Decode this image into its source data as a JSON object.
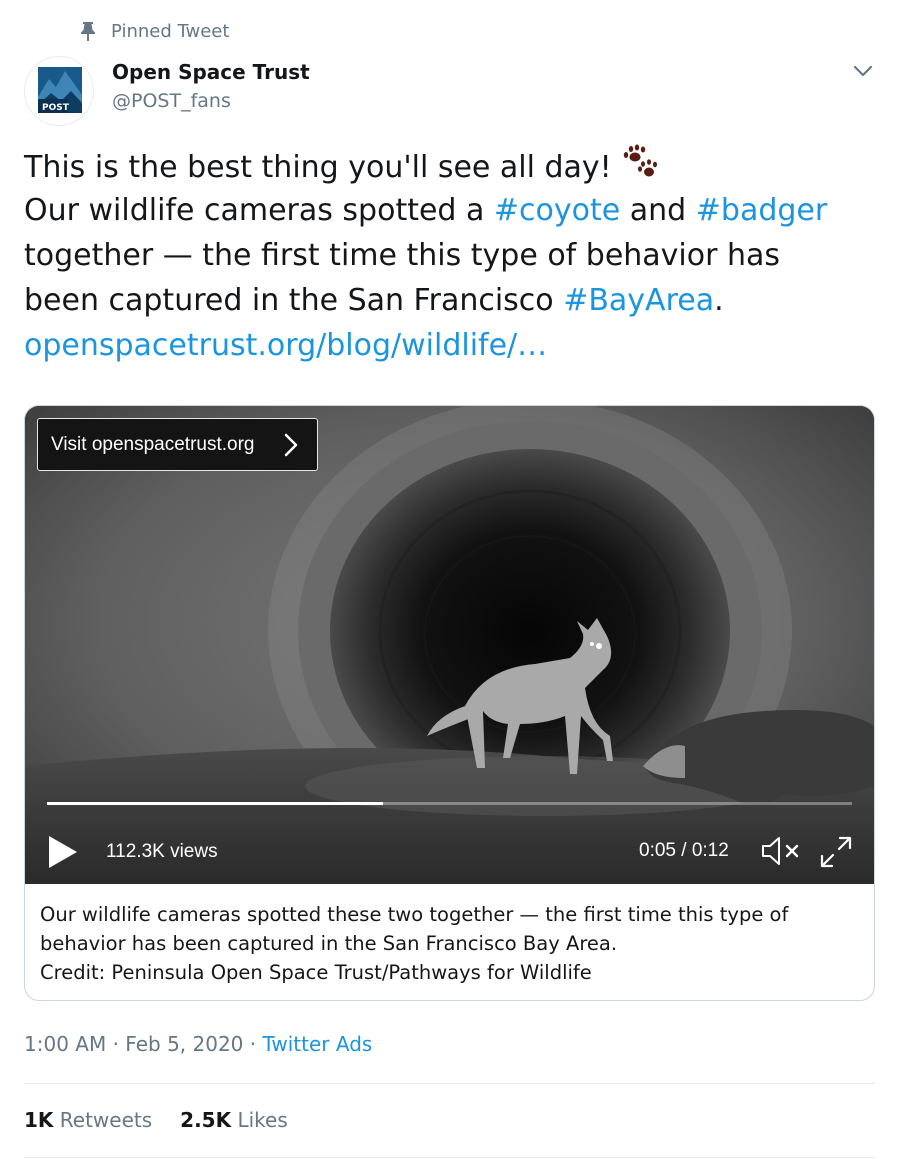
{
  "pinned": {
    "label": "Pinned Tweet",
    "icon": "pin-icon"
  },
  "author": {
    "display_name": "Open Space Trust",
    "handle": "@POST_fans",
    "avatar_text": "POST",
    "menu_icon": "chevron-down-icon"
  },
  "tweet": {
    "line1": "This is the best thing you'll see all day!",
    "line1_icon": "paw-prints-icon",
    "line2_prefix": "Our wildlife cameras spotted a ",
    "hashtag_coyote": "#coyote",
    "line2_middle": " and ",
    "hashtag_badger": "#badger",
    "line3": " together — the first time this type of behavior has",
    "line4_prefix": "been captured in the San Francisco ",
    "hashtag_bayarea": "#BayArea",
    "line4_suffix": ".",
    "link": "openspacetrust.org/blog/wildlife/…"
  },
  "video": {
    "visit_label": "Visit openspacetrust.org",
    "views": "112.3K views",
    "time": "0:05 / 0:12",
    "progress": 0.417,
    "icons": {
      "play": "play-icon",
      "mute": "muted-speaker-icon",
      "fullscreen": "fullscreen-icon",
      "visit": "chevron-right-icon"
    }
  },
  "caption": {
    "line1": "Our wildlife cameras spotted these two together — the first time this type of",
    "line2": "behavior has been captured in the San Francisco Bay Area.",
    "line3": "Credit: Peninsula Open Space Trust/Pathways for Wildlife"
  },
  "meta": {
    "time": "1:00 AM",
    "separator": " · ",
    "date": "Feb 5, 2020",
    "source": "Twitter Ads"
  },
  "stats": {
    "retweets_count": "1K",
    "retweets_label": " Retweets",
    "likes_count": "2.5K",
    "likes_label": " Likes"
  },
  "colors": {
    "link": "#1b95e0",
    "secondary_text": "#657786",
    "primary_text": "#14171a",
    "paw": "#5a1e10"
  }
}
